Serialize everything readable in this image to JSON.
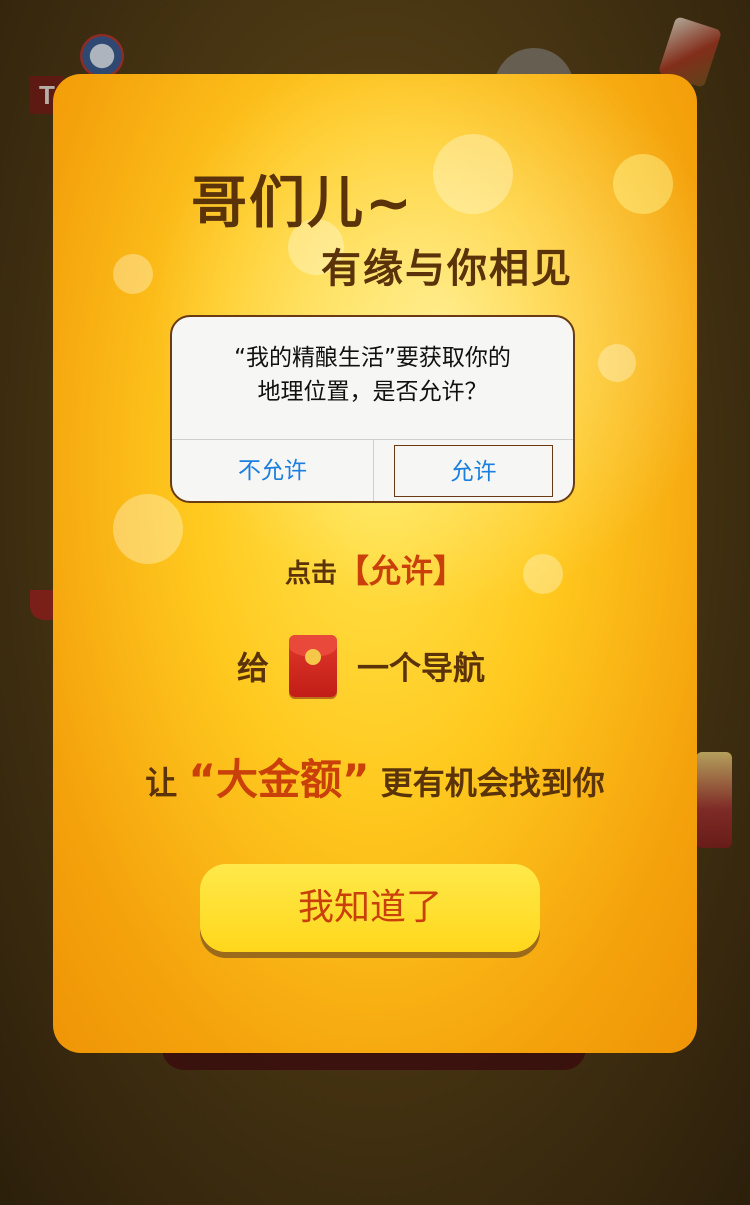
{
  "background": {
    "tag_text": "T"
  },
  "card": {
    "title_line1": "哥们儿~",
    "title_line2": "有缘与你相见"
  },
  "dialog": {
    "message_line1": "“我的精酿生活”要获取你的",
    "message_line2": "地理位置，是否允许？",
    "deny_label": "不允许",
    "allow_label": "允许"
  },
  "hints": {
    "line1_prefix": "点击",
    "line1_accent": "【允许】",
    "line2_prefix": "给",
    "line2_suffix": "一个导航",
    "line3_prefix": "让",
    "line3_accent": "“大金额”",
    "line3_suffix": "更有机会找到你"
  },
  "ok_button": {
    "label": "我知道了"
  },
  "colors": {
    "brown_text": "#5a330a",
    "accent_orange": "#c9400a",
    "ios_blue": "#1b7fe0",
    "button_yellow": "#ffd71c"
  }
}
